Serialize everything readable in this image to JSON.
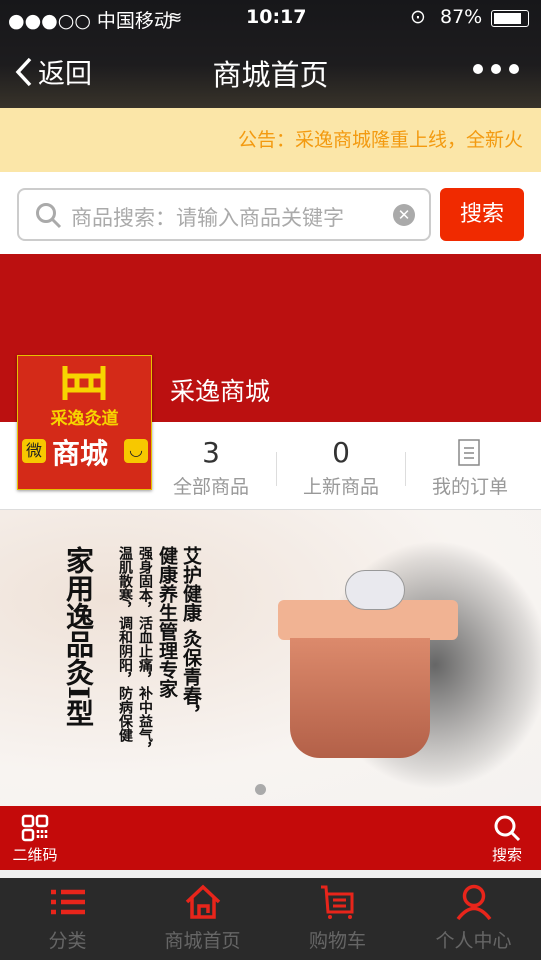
{
  "status_bar": {
    "carrier": "●●●○○ 中国移动",
    "time": "10:17",
    "battery": "87%"
  },
  "nav": {
    "back_label": "返回",
    "title": "商城首页"
  },
  "notice": {
    "text": "公告：采逸商城隆重上线，全新火"
  },
  "search": {
    "placeholder": "商品搜索：请输入商品关键字",
    "button_label": "搜索"
  },
  "shop": {
    "name": "采逸商城",
    "logo_text": "采逸灸道",
    "logo_sub": "商城",
    "logo_left": "微"
  },
  "stats": [
    {
      "value": "3",
      "label": "全部商品"
    },
    {
      "value": "0",
      "label": "上新商品"
    },
    {
      "label": "我的订单"
    }
  ],
  "banner": {
    "columns": [
      "艾护健康 灸保青春，",
      "健康养生管理专家",
      "强身固本，活血止痛，补中益气，",
      "温肌散寒，调和阴阳，防病保健",
      "家用逸品灸I型"
    ]
  },
  "bottom_bar": {
    "qr_label": "二维码",
    "search_label": "搜索"
  },
  "tabs": [
    {
      "label": "分类"
    },
    {
      "label": "商城首页"
    },
    {
      "label": "购物车"
    },
    {
      "label": "个人中心"
    }
  ],
  "colors": {
    "red": "#bb1010",
    "accent": "#f02a00",
    "tab_icon": "#e8251b"
  }
}
